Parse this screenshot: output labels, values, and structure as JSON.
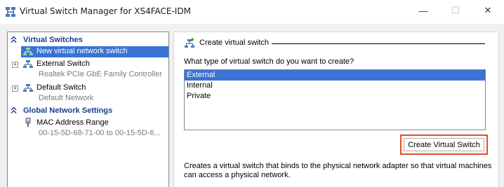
{
  "window": {
    "title": "Virtual Switch Manager for XS4FACE-IDM",
    "minimize_glyph": "—",
    "maximize_glyph": "☐",
    "close_glyph": "✕"
  },
  "sidebar": {
    "virtual_switches_header": "Virtual Switches",
    "items": [
      {
        "label": "New virtual network switch",
        "selected": true
      },
      {
        "label": "External Switch",
        "sub": "Realtek PCIe GbE Family Controller",
        "expander": "+"
      },
      {
        "label": "Default Switch",
        "sub": "Default Network",
        "expander": "+"
      }
    ],
    "global_header": "Global Network Settings",
    "mac": {
      "label": "MAC Address Range",
      "sub": "00-15-5D-68-71-00 to 00-15-5D-6..."
    }
  },
  "main": {
    "section_title": "Create virtual switch",
    "question": "What type of virtual switch do you want to create?",
    "types": [
      "External",
      "Internal",
      "Private"
    ],
    "selected_type": "External",
    "create_button": "Create Virtual Switch",
    "description": "Creates a virtual switch that binds to the physical network adapter so that virtual machines can access a physical network."
  },
  "colors": {
    "selection": "#3a73d3",
    "header_blue": "#1a3d8f",
    "highlight_border": "#e0502a"
  }
}
